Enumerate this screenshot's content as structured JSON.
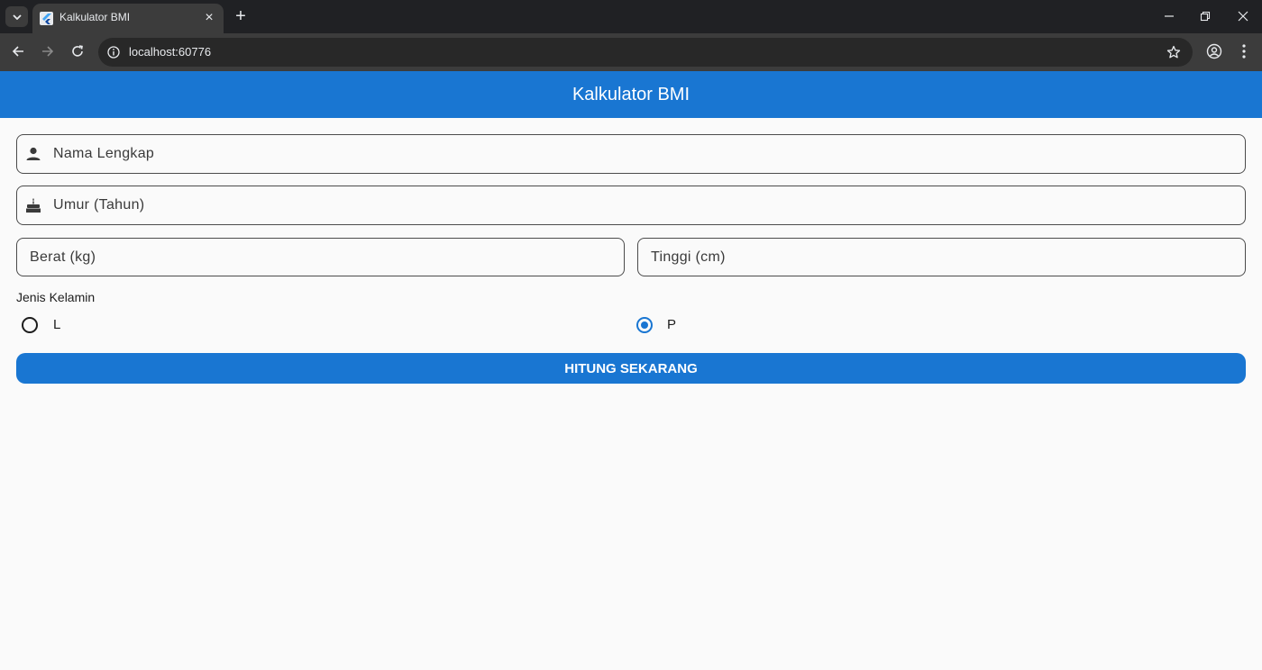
{
  "browser": {
    "tab_title": "Kalkulator BMI",
    "url": "localhost:60776"
  },
  "app": {
    "title": "Kalkulator BMI",
    "primary_color": "#1976d2"
  },
  "form": {
    "name_placeholder": "Nama Lengkap",
    "name_icon": "person-icon",
    "age_placeholder": "Umur (Tahun)",
    "age_icon": "cake-icon",
    "weight_placeholder": "Berat (kg)",
    "height_placeholder": "Tinggi (cm)",
    "gender_label": "Jenis Kelamin",
    "gender_options": [
      {
        "label": "L",
        "selected": false
      },
      {
        "label": "P",
        "selected": true
      }
    ],
    "submit_label": "HITUNG SEKARANG"
  }
}
